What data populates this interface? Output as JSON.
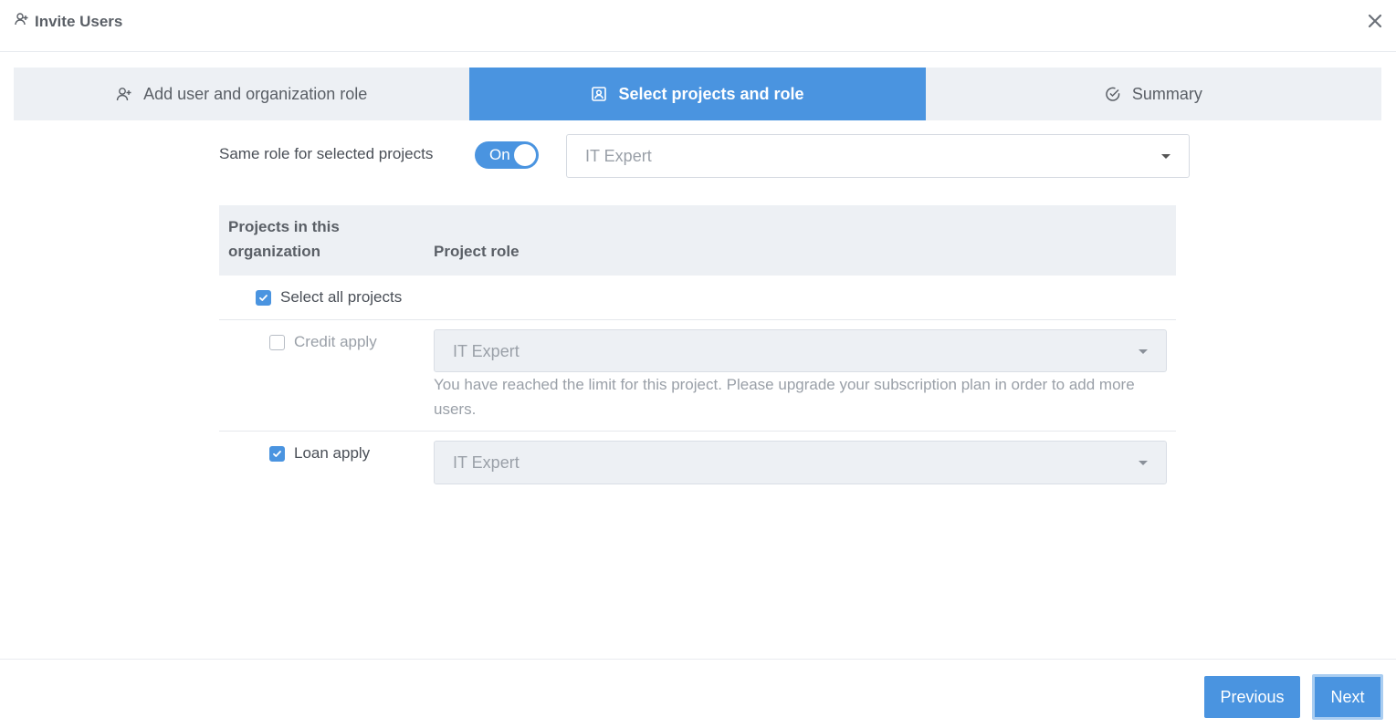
{
  "header": {
    "title": "Invite Users",
    "icon": "user-plus-icon",
    "close_icon": "close-icon"
  },
  "tabs": [
    {
      "label": "Add user and organization role",
      "icon": "user-plus-icon",
      "active": false
    },
    {
      "label": "Select projects and role",
      "icon": "id-badge-icon",
      "active": true
    },
    {
      "label": "Summary",
      "icon": "check-circle-icon",
      "active": false
    }
  ],
  "same_role": {
    "label": "Same role for selected projects",
    "toggle_label": "On",
    "toggle_on": true,
    "role_value": "IT Expert"
  },
  "table": {
    "col_projects": "Projects in this organization",
    "col_role": "Project role",
    "select_all_label": "Select all projects",
    "select_all_checked": true,
    "rows": [
      {
        "name": "Credit apply",
        "checked": false,
        "role": "IT Expert",
        "message": "You have reached the limit for this project. Please upgrade your subscription plan in order to add more users."
      },
      {
        "name": "Loan apply",
        "checked": true,
        "role": "IT Expert"
      }
    ]
  },
  "footer": {
    "previous_label": "Previous",
    "next_label": "Next"
  },
  "colors": {
    "accent": "#4a94e0",
    "tab_bg": "#edf0f4",
    "text": "#4a4f57",
    "muted": "#9aa0a8"
  }
}
